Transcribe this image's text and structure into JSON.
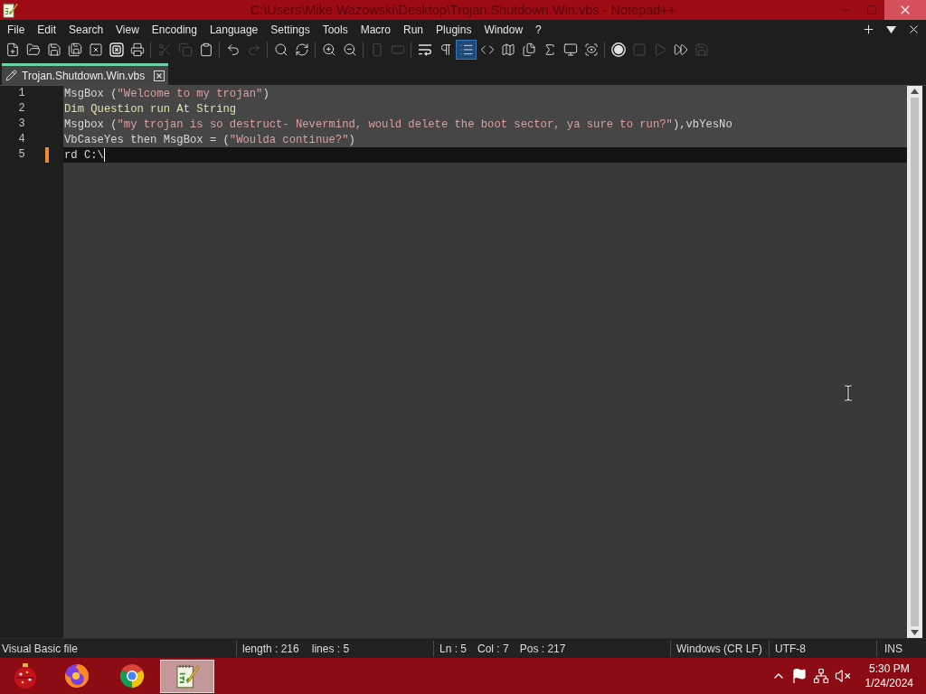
{
  "window": {
    "title": "C:\\Users\\Mike Wazowski\\Desktop\\Trojan.Shutdown.Win.vbs - Notepad++"
  },
  "menu": [
    "File",
    "Edit",
    "Search",
    "View",
    "Encoding",
    "Language",
    "Settings",
    "Tools",
    "Macro",
    "Run",
    "Plugins",
    "Window",
    "?"
  ],
  "toolbar": {
    "groups": [
      [
        {
          "disabled": false,
          "on": false
        },
        {
          "disabled": false,
          "on": false
        },
        {
          "disabled": false,
          "on": false
        },
        {
          "disabled": false,
          "on": false
        },
        {
          "disabled": false,
          "on": false
        },
        {
          "disabled": false,
          "on": false
        },
        {
          "disabled": false,
          "on": false
        }
      ],
      [
        {
          "disabled": true,
          "on": false
        },
        {
          "disabled": true,
          "on": false
        },
        {
          "disabled": false,
          "on": false
        }
      ],
      [
        {
          "disabled": false,
          "on": false
        },
        {
          "disabled": true,
          "on": false
        }
      ],
      [
        {
          "disabled": false,
          "on": false
        },
        {
          "disabled": false,
          "on": false
        }
      ],
      [
        {
          "disabled": false,
          "on": false
        },
        {
          "disabled": false,
          "on": false
        }
      ],
      [
        {
          "disabled": true,
          "on": false
        },
        {
          "disabled": true,
          "on": false
        }
      ],
      [
        {
          "disabled": false,
          "on": false
        },
        {
          "disabled": false,
          "on": false
        },
        {
          "disabled": false,
          "on": true
        },
        {
          "disabled": false,
          "on": false
        },
        {
          "disabled": false,
          "on": false
        },
        {
          "disabled": false,
          "on": false
        },
        {
          "disabled": false,
          "on": false
        },
        {
          "disabled": false,
          "on": false
        },
        {
          "disabled": false,
          "on": false
        }
      ],
      [
        {
          "disabled": false,
          "on": false
        },
        {
          "disabled": true,
          "on": false
        },
        {
          "disabled": true,
          "on": false
        },
        {
          "disabled": false,
          "on": false
        },
        {
          "disabled": true,
          "on": false
        }
      ]
    ]
  },
  "tabs": [
    {
      "label": "Trojan.Shutdown.Win.vbs",
      "selected": true
    }
  ],
  "editor": {
    "lines": [
      {
        "number": "1",
        "selected": true,
        "current": false,
        "modified": false,
        "tokens": [
          {
            "kind": "plain",
            "text": "MsgBox ("
          },
          {
            "kind": "string",
            "text": "\"Welcome to my trojan\""
          },
          {
            "kind": "plain",
            "text": ")"
          }
        ]
      },
      {
        "number": "2",
        "selected": true,
        "current": false,
        "modified": false,
        "tokens": [
          {
            "kind": "keyword",
            "text": "Dim Question run At String"
          }
        ]
      },
      {
        "number": "3",
        "selected": true,
        "current": false,
        "modified": false,
        "tokens": [
          {
            "kind": "plain",
            "text": "Msgbox ("
          },
          {
            "kind": "string",
            "text": "\"my trojan is so destruct- Nevermind, would delete the boot sector, ya sure to run?\""
          },
          {
            "kind": "plain",
            "text": "),vbYesNo"
          }
        ]
      },
      {
        "number": "4",
        "selected": true,
        "current": false,
        "modified": false,
        "tokens": [
          {
            "kind": "plain",
            "text": "VbCaseYes then MsgBox = ("
          },
          {
            "kind": "string",
            "text": "\"Woulda continue?\""
          },
          {
            "kind": "plain",
            "text": ")"
          }
        ]
      },
      {
        "number": "5",
        "selected": false,
        "current": true,
        "modified": true,
        "tokens": [
          {
            "kind": "plain",
            "text": "rd C:\\"
          }
        ]
      }
    ]
  },
  "status_bar": {
    "file_type": "Visual Basic file",
    "length": "length : 216",
    "lines": "lines : 5",
    "ln": "Ln : 5",
    "col": "Col : 7",
    "pos": "Pos : 217",
    "eol": "Windows (CR LF)",
    "encoding": "UTF-8",
    "mode": "INS"
  },
  "taskbar": {
    "apps": [
      {
        "selected": false
      },
      {
        "selected": false
      },
      {
        "selected": true
      }
    ],
    "time": "5:30 PM",
    "date": "1/24/2024"
  }
}
